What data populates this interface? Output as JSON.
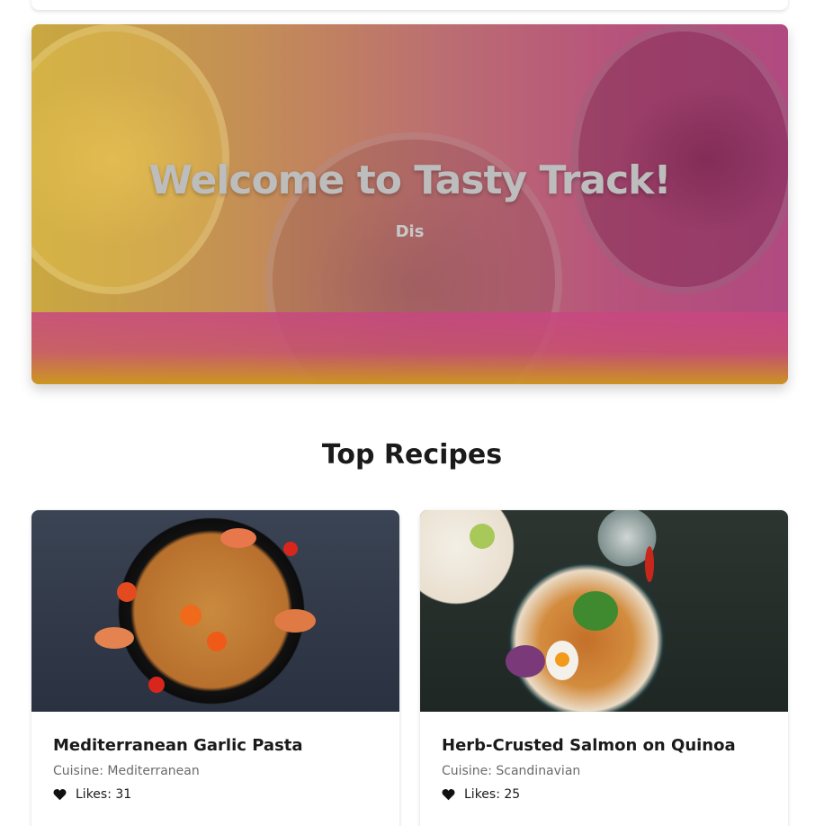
{
  "hero": {
    "title": "Welcome to Tasty Track!",
    "subtitle": "Dis"
  },
  "section": {
    "title": "Top Recipes"
  },
  "recipes": [
    {
      "title": "Mediterranean Garlic Pasta",
      "cuisine": "Cuisine: Mediterranean",
      "likes": "Likes: 31",
      "image_icon": "pasta-photo"
    },
    {
      "title": "Herb-Crusted Salmon on Quinoa",
      "cuisine": "Cuisine: Scandinavian",
      "likes": "Likes: 25",
      "image_icon": "salmon-bowl-photo"
    }
  ],
  "colors": {
    "hero_gradient_start": "#c9a840",
    "hero_gradient_end": "#b04a80",
    "heading": "#1a1a1a",
    "muted_text": "#6b6b6b"
  }
}
